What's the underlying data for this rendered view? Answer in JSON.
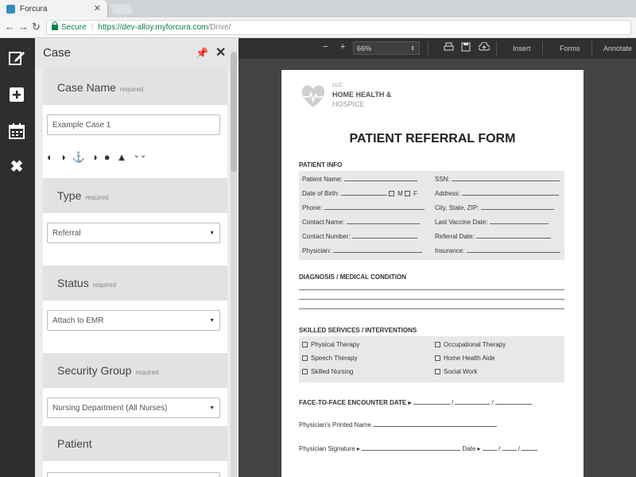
{
  "browser": {
    "tab_title": "Forcura",
    "url_secure": "Secure",
    "url_scheme": "https://",
    "url_host": "dev-alloy.myforcura.com",
    "url_path": "/Drive/"
  },
  "panel": {
    "title": "Case",
    "case_name": {
      "label": "Case Name",
      "required": "required",
      "value": "Example Case 1"
    },
    "type": {
      "label": "Type",
      "required": "required",
      "value": "Referral"
    },
    "status": {
      "label": "Status",
      "required": "required",
      "value": "Attach to EMR"
    },
    "security_group": {
      "label": "Security Group",
      "required": "required",
      "value": "Nursing Department (All Nurses)"
    },
    "patient": {
      "label": "Patient"
    }
  },
  "viewer": {
    "zoom": "66%",
    "insert": "Insert",
    "forms": "Forms",
    "annotate": "Annotate"
  },
  "document": {
    "logo_llc": "LLC",
    "logo_line1": "HOME HEALTH &",
    "logo_line2": "HOSPICE",
    "title": "PATIENT REFERRAL FORM",
    "patient_info_title": "PATIENT INFO",
    "left_fields": [
      "Patient Name:",
      "Date of Birth:",
      "Phone:",
      "Contact Name:",
      "Contact Number:",
      "Physician:"
    ],
    "right_fields": [
      "SSN:",
      "Address:",
      "City, State, ZIP:",
      "Last Vaccine Date:",
      "Referral Date:",
      "Insurance:"
    ],
    "sex_m": "M",
    "sex_f": "F",
    "diagnosis_title": "DIAGNOSIS / MEDICAL CONDITION",
    "skilled_title": "SKILLED SERVICES / INTERVENTIONS",
    "services_left": [
      "Physical Therapy",
      "Speech Therapy",
      "Skilled Nursing"
    ],
    "services_right": [
      "Occupational Therapy",
      "Home Health Aide",
      "Social Work"
    ],
    "face_label": "FACE-TO-FACE ENCOUNTER DATE ▸",
    "slash": "/",
    "printed_name": "Physician's Printed Name",
    "signature": "Physician Signature ▸",
    "date": "Date ▸"
  }
}
